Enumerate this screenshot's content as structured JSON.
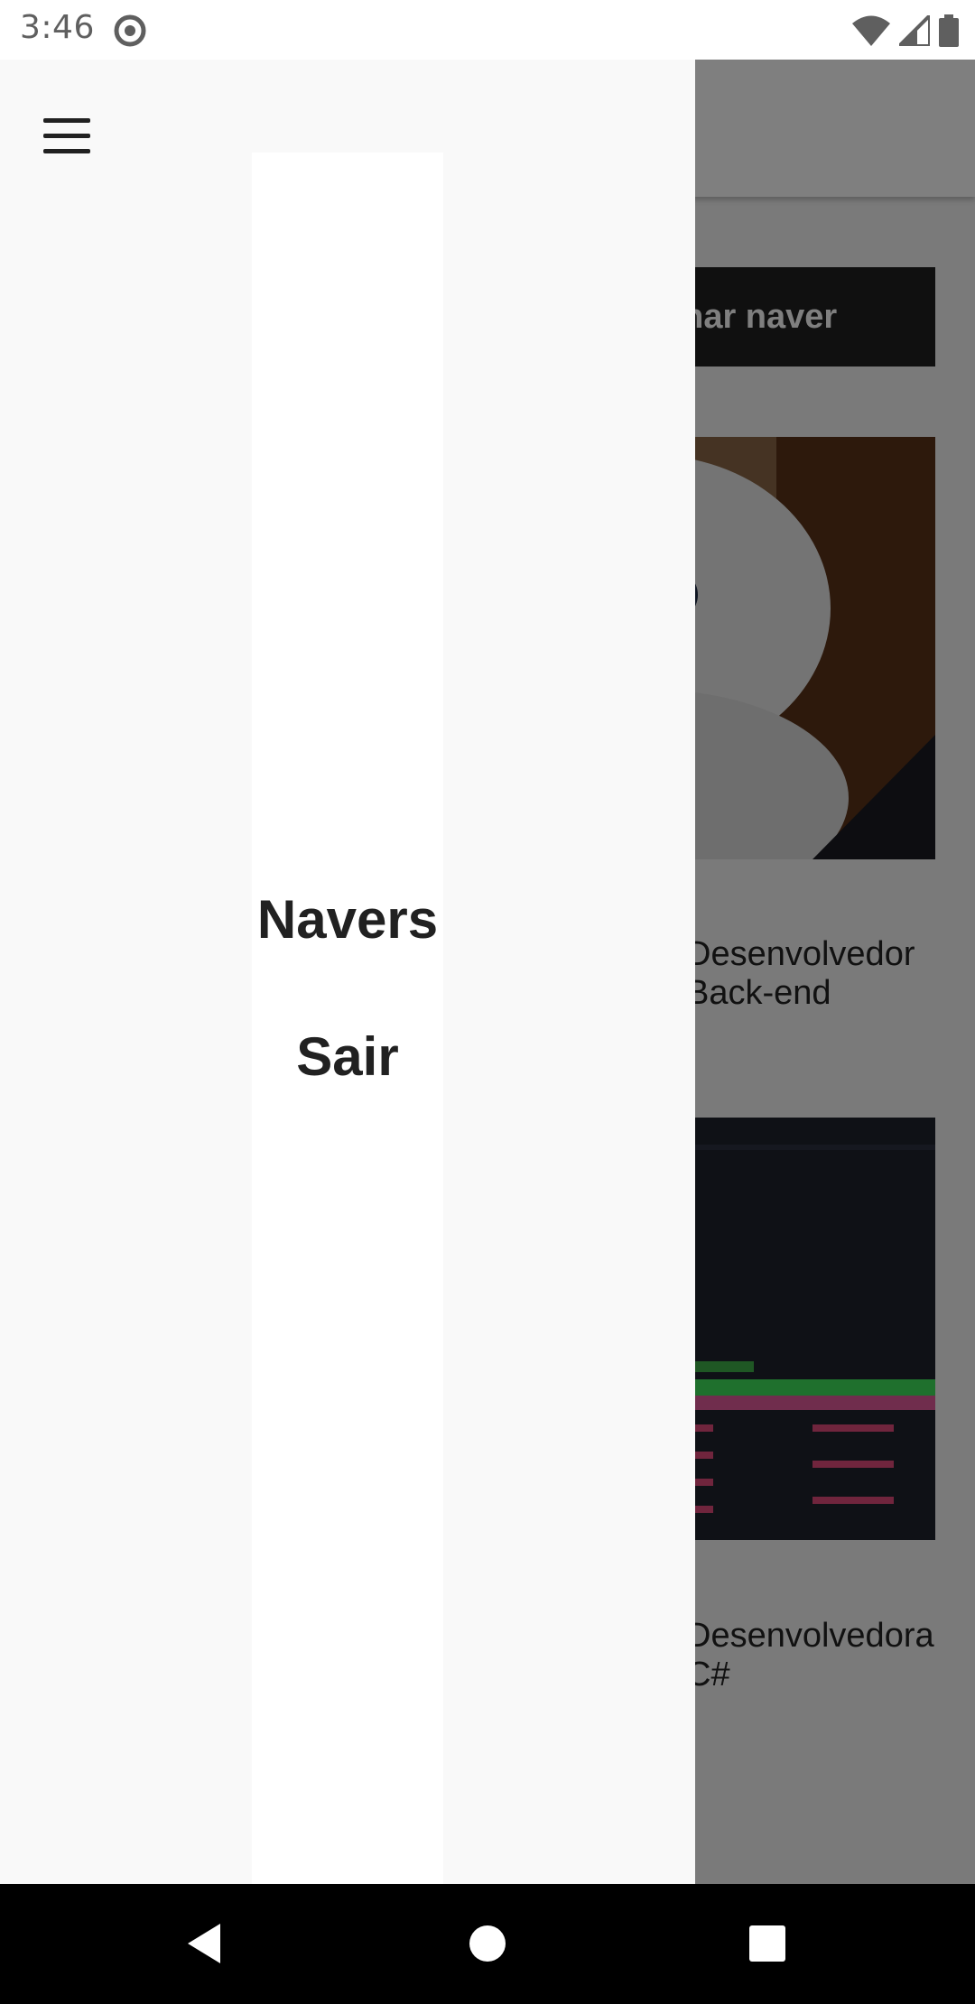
{
  "status_bar": {
    "time": "3:46",
    "icons": [
      "sync-icon",
      "wifi-icon",
      "signal-icon",
      "battery-icon"
    ]
  },
  "background_screen": {
    "add_button_label": "Adicionar naver",
    "navers": [
      {
        "name": "",
        "role": "Desenvolvedor Back-end",
        "photo": "robot-photo"
      },
      {
        "name": "",
        "role": "Desenvolvedora C#",
        "photo": "terminal-code-photo"
      }
    ]
  },
  "drawer": {
    "items": [
      {
        "label": "Navers"
      },
      {
        "label": "Sair"
      }
    ]
  },
  "nav_bar": {
    "icons": [
      "back-icon",
      "home-icon",
      "recents-icon"
    ]
  },
  "colors": {
    "drawer_background": "#f9f9f9",
    "text_primary": "#212121",
    "scrim": "rgba(0,0,0,0.5)"
  }
}
